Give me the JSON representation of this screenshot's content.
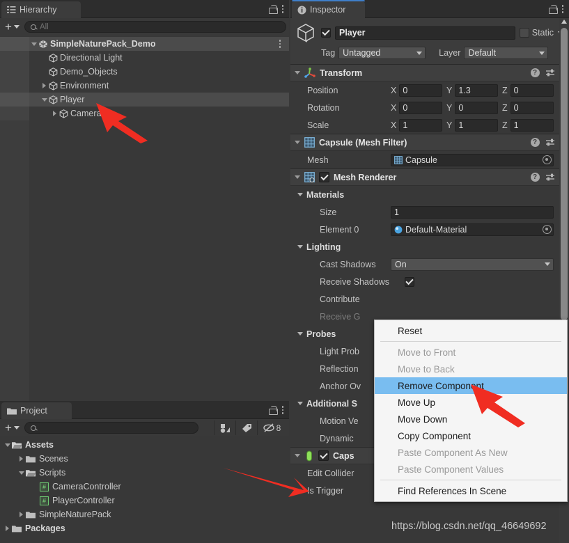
{
  "hierarchy": {
    "tab_label": "Hierarchy",
    "tab_icon": "hierarchy-list-icon",
    "toolbar": {
      "add_label": "+",
      "search_placeholder": "All",
      "search_value": ""
    },
    "items": [
      {
        "label": "SimpleNaturePack_Demo",
        "depth": 1,
        "expanded": true,
        "has_children": true,
        "icon": "prefab-icon",
        "bold": true,
        "highlighted": true,
        "kebab": true
      },
      {
        "label": "Directional Light",
        "depth": 2,
        "expanded": false,
        "has_children": false,
        "icon": "gameobject-cube-icon",
        "bold": false,
        "highlighted": false,
        "kebab": false
      },
      {
        "label": "Demo_Objects",
        "depth": 2,
        "expanded": false,
        "has_children": false,
        "icon": "gameobject-cube-icon",
        "bold": false,
        "highlighted": false,
        "kebab": false
      },
      {
        "label": "Environment",
        "depth": 2,
        "expanded": false,
        "has_children": true,
        "icon": "gameobject-cube-icon",
        "bold": false,
        "highlighted": false,
        "kebab": false
      },
      {
        "label": "Player",
        "depth": 2,
        "expanded": true,
        "has_children": true,
        "icon": "gameobject-cube-icon",
        "bold": false,
        "highlighted": true,
        "kebab": false
      },
      {
        "label": "Cameras",
        "depth": 3,
        "expanded": false,
        "has_children": true,
        "icon": "gameobject-cube-icon",
        "bold": false,
        "highlighted": false,
        "kebab": false
      }
    ]
  },
  "project": {
    "tab_label": "Project",
    "tab_icon": "folder-icon",
    "toolbar": {
      "add_label": "+",
      "search_placeholder": "",
      "search_value": "",
      "filter_by_type_icon": "search-by-type-icon",
      "filter_by_label_icon": "search-by-label-icon",
      "hidden_packages_icon": "hidden-eye-icon",
      "hidden_packages_count": "8"
    },
    "items": [
      {
        "label": "Assets",
        "depth": 0,
        "expanded": true,
        "has_children": true,
        "icon": "folder-open-icon",
        "bold": true
      },
      {
        "label": "Scenes",
        "depth": 1,
        "expanded": false,
        "has_children": true,
        "icon": "folder-icon",
        "bold": false
      },
      {
        "label": "Scripts",
        "depth": 1,
        "expanded": true,
        "has_children": true,
        "icon": "folder-open-icon",
        "bold": false
      },
      {
        "label": "CameraController",
        "depth": 2,
        "expanded": false,
        "has_children": false,
        "icon": "csharp-script-icon",
        "bold": false
      },
      {
        "label": "PlayerController",
        "depth": 2,
        "expanded": false,
        "has_children": false,
        "icon": "csharp-script-icon",
        "bold": false
      },
      {
        "label": "SimpleNaturePack",
        "depth": 1,
        "expanded": false,
        "has_children": true,
        "icon": "folder-icon",
        "bold": false
      },
      {
        "label": "Packages",
        "depth": 0,
        "expanded": false,
        "has_children": true,
        "icon": "folder-icon",
        "bold": true
      }
    ]
  },
  "inspector": {
    "tab_label": "Inspector",
    "tab_icon": "info-icon",
    "object": {
      "enabled": true,
      "name": "Player",
      "static_label": "Static",
      "static_checked": false,
      "tag_label": "Tag",
      "tag_value": "Untagged",
      "layer_label": "Layer",
      "layer_value": "Default"
    },
    "components": [
      {
        "name": "Transform",
        "icon": "transform-axis-icon",
        "has_enable_toggle": false,
        "expanded": true,
        "rows": [
          {
            "kind": "vector3",
            "label": "Position",
            "x": "0",
            "y": "1.3",
            "z": "0"
          },
          {
            "kind": "vector3",
            "label": "Rotation",
            "x": "0",
            "y": "0",
            "z": "0"
          },
          {
            "kind": "vector3",
            "label": "Scale",
            "x": "1",
            "y": "1",
            "z": "1"
          }
        ]
      },
      {
        "name": "Capsule (Mesh Filter)",
        "icon": "mesh-filter-icon",
        "has_enable_toggle": false,
        "expanded": true,
        "rows": [
          {
            "kind": "object",
            "label": "Mesh",
            "value": "Capsule",
            "value_icon": "mesh-icon"
          }
        ]
      },
      {
        "name": "Mesh Renderer",
        "icon": "mesh-renderer-icon",
        "has_enable_toggle": true,
        "enabled": true,
        "expanded": true,
        "rows": [
          {
            "kind": "group",
            "label": "Materials"
          },
          {
            "kind": "text",
            "label": "Size",
            "value": "1"
          },
          {
            "kind": "object",
            "label": "Element 0",
            "value": "Default-Material",
            "value_icon": "material-sphere-icon"
          },
          {
            "kind": "group",
            "label": "Lighting"
          },
          {
            "kind": "select",
            "label": "Cast Shadows",
            "value": "On"
          },
          {
            "kind": "check",
            "label": "Receive Shadows",
            "checked": true
          },
          {
            "kind": "check",
            "label": "Contribute Global Illumination",
            "short": "Contribute",
            "checked": false
          },
          {
            "kind": "check",
            "label": "Receive Global Illumination",
            "short": "Receive G",
            "disabled": true
          },
          {
            "kind": "group",
            "label": "Probes"
          },
          {
            "kind": "select",
            "label": "Light Probes",
            "short": "Light Prob"
          },
          {
            "kind": "select",
            "label": "Reflection Probes",
            "short": "Reflection"
          },
          {
            "kind": "object",
            "label": "Anchor Override",
            "short": "Anchor Ov"
          },
          {
            "kind": "group",
            "label": "Additional Settings",
            "short": "Additional S"
          },
          {
            "kind": "select",
            "label": "Motion Vectors",
            "short": "Motion Ve"
          },
          {
            "kind": "check",
            "label": "Dynamic Occlusion",
            "short": "Dynamic"
          }
        ]
      },
      {
        "name": "Capsule Collider",
        "short_name": "Caps",
        "icon": "capsule-collider-icon",
        "has_enable_toggle": true,
        "enabled": true,
        "expanded": true,
        "rows": [
          {
            "kind": "editcollider",
            "label": "Edit Collider"
          },
          {
            "kind": "check",
            "label": "Is Trigger",
            "checked": false
          }
        ]
      }
    ]
  },
  "context_menu": {
    "items": [
      {
        "label": "Reset",
        "state": "normal"
      },
      {
        "label": "__separator__",
        "state": "separator"
      },
      {
        "label": "Move to Front",
        "state": "disabled"
      },
      {
        "label": "Move to Back",
        "state": "disabled"
      },
      {
        "label": "Remove Component",
        "state": "selected"
      },
      {
        "label": "Move Up",
        "state": "normal"
      },
      {
        "label": "Move Down",
        "state": "normal"
      },
      {
        "label": "Copy Component",
        "state": "normal"
      },
      {
        "label": "Paste Component As New",
        "state": "disabled"
      },
      {
        "label": "Paste Component Values",
        "state": "disabled"
      },
      {
        "label": "__separator__",
        "state": "separator"
      },
      {
        "label": "Find References In Scene",
        "state": "normal"
      }
    ]
  },
  "annotations": {
    "watermark": "https://blog.csdn.net/qq_46649692",
    "arrow_color": "#f02d22",
    "arrows": [
      {
        "name": "arrow-to-player-hierarchy"
      },
      {
        "name": "arrow-to-remove-component"
      },
      {
        "name": "arrow-to-capsule-collider"
      }
    ]
  },
  "colors": {
    "panel_bg": "#383838",
    "tab_bg": "#2d2d2d",
    "field_bg": "#2a2a2a",
    "accent_blue": "#3f7fca",
    "menu_highlight": "#79bdf0",
    "menu_bg": "#f5f5f5",
    "text": "#c8c8c8"
  }
}
